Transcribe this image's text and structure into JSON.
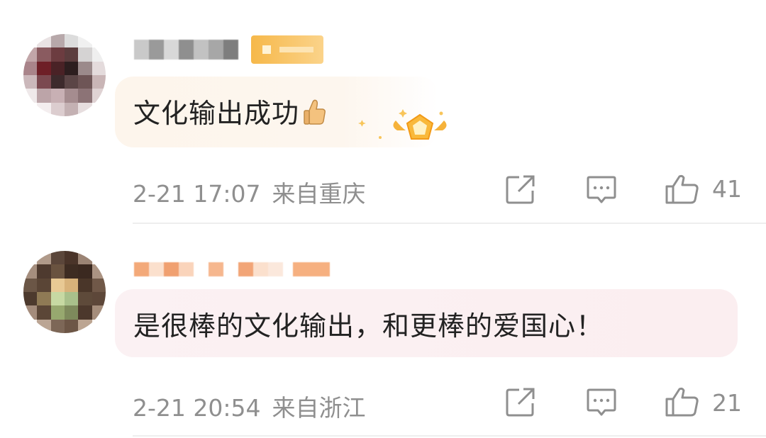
{
  "comments": [
    {
      "text": "文化输出成功",
      "emoji": "thumbs-up",
      "has_medal": true,
      "time": "2-21 17:07",
      "location": "来自重庆",
      "likes": "41",
      "icons": [
        "share-icon",
        "comment-icon",
        "like-icon"
      ]
    },
    {
      "text": "是很棒的文化输出，和更棒的爱国心！",
      "has_medal": false,
      "time": "2-21 20:54",
      "location": "来自浙江",
      "likes": "21",
      "icons": [
        "share-icon",
        "comment-icon",
        "like-icon"
      ]
    }
  ],
  "colors": {
    "meta_text": "#8f8f8f",
    "body_text": "#222222",
    "badge": "#f6b84a",
    "bubble_1": "#fdf5ec",
    "bubble_2": "#fbeef0"
  }
}
